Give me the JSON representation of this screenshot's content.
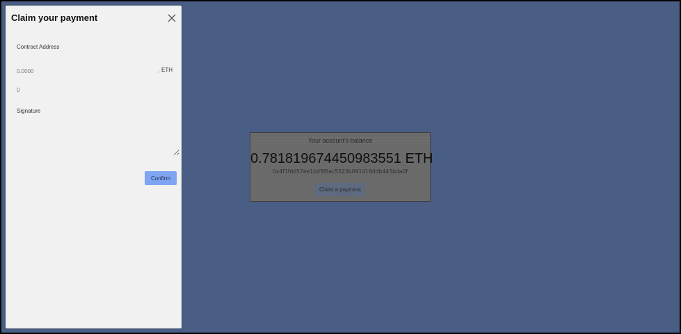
{
  "drawer": {
    "title": "Claim your payment",
    "contract_address_label": "Contract Address",
    "contract_address_value": "",
    "amount_placeholder": "0.0000",
    "amount_unit": "ETH",
    "nonce_placeholder": "0",
    "signature_label": "Signature",
    "signature_value": "",
    "confirm_label": "Confirm"
  },
  "balance_card": {
    "caption": "Your account's balance",
    "amount": "0.781819674450983551 ETH",
    "address": "0x4f1fdd57ee1bd5f6ac5523b091419ddb445bda0f",
    "claim_button_label": "Claim a payment"
  },
  "icons": {
    "close": "close-icon"
  },
  "colors": {
    "backdrop": "#4a5e85",
    "drawer_bg": "#f1f1f1",
    "confirm_button": "#7fa4f2"
  }
}
